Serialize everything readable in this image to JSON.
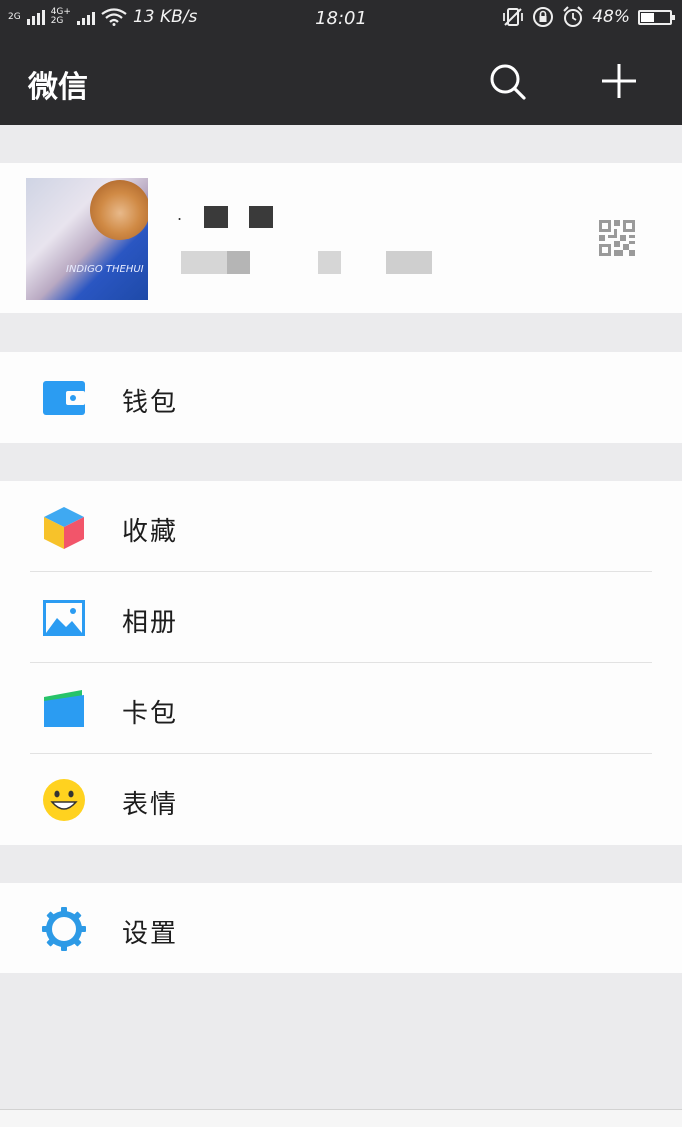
{
  "status_bar": {
    "net1_top": "2G",
    "net2_top": "4G+",
    "net2_bottom": "2G",
    "speed": "13 KB/s",
    "time": "18:01",
    "battery_percent": "48%",
    "battery_level": 0.48
  },
  "header": {
    "title": "微信",
    "search_icon": "search-icon",
    "add_icon": "plus-icon"
  },
  "profile": {
    "avatar_shirt_text": "INDIGO THEHUI",
    "name_prefix": ".",
    "qr_icon": "qr-code-icon"
  },
  "menu": {
    "wallet": {
      "label": "钱包",
      "icon": "wallet-icon",
      "color": "#2b9cf2"
    },
    "favorites": {
      "label": "收藏",
      "icon": "cube-icon"
    },
    "album": {
      "label": "相册",
      "icon": "picture-icon",
      "color": "#2b9cf2"
    },
    "cards": {
      "label": "卡包",
      "icon": "card-wallet-icon"
    },
    "stickers": {
      "label": "表情",
      "icon": "smiley-icon",
      "color": "#ffd21f"
    },
    "settings": {
      "label": "设置",
      "icon": "gear-icon",
      "color": "#2d9ae6"
    }
  },
  "colors": {
    "header_bg": "#2b2b2d",
    "page_bg": "#ebebed",
    "card_bg": "#fdfdfd"
  }
}
